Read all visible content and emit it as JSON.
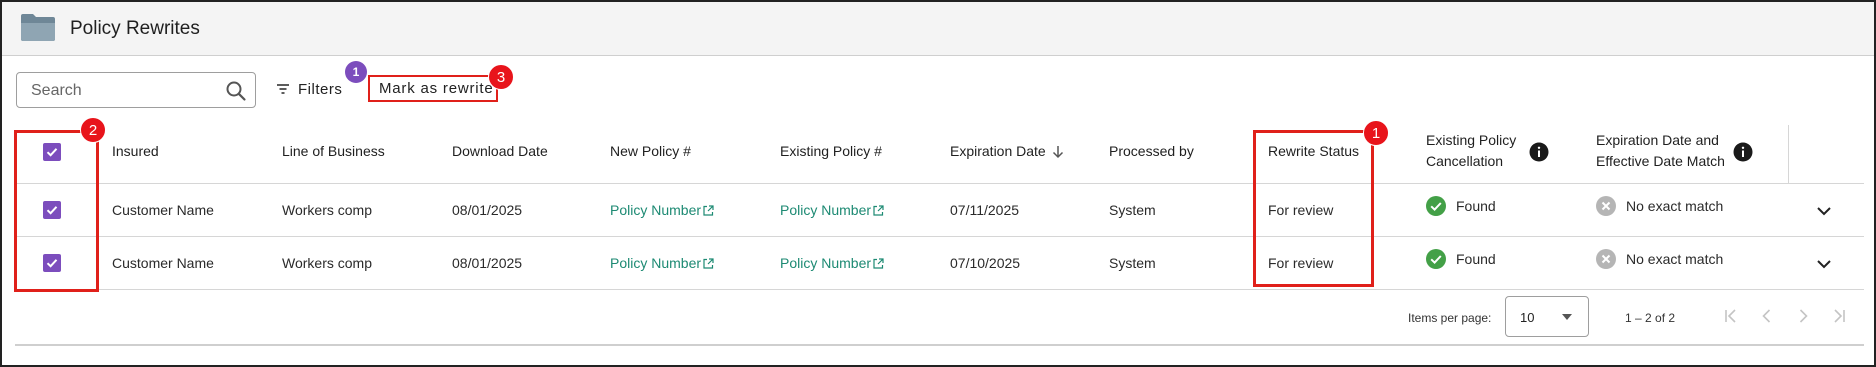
{
  "header": {
    "title": "Policy Rewrites",
    "icon": "folder-icon"
  },
  "toolbar": {
    "search_placeholder": "Search",
    "filters_label": "Filters",
    "filters_count": "1",
    "mark_rewrite_label": "Mark as rewrite"
  },
  "callouts": {
    "select_column": "2",
    "rewrite_status": "1",
    "mark_button": "3"
  },
  "table": {
    "columns": {
      "insured": "Insured",
      "line_of_business": "Line of Business",
      "download_date": "Download Date",
      "new_policy": "New Policy #",
      "existing_policy": "Existing Policy #",
      "expiration_date": "Expiration Date",
      "processed_by": "Processed by",
      "rewrite_status": "Rewrite Status",
      "existing_policy_cancellation_1": "Existing Policy",
      "existing_policy_cancellation_2": "Cancellation",
      "expiration_effective_match_1": "Expiration Date and",
      "expiration_effective_match_2": "Effective Date Match"
    },
    "rows": [
      {
        "insured": "Customer Name",
        "line_of_business": "Workers comp",
        "download_date": "08/01/2025",
        "new_policy": "Policy Number",
        "existing_policy": "Policy Number",
        "expiration_date": "07/11/2025",
        "processed_by": "System",
        "rewrite_status": "For review",
        "cancellation": "Found",
        "date_match": "No exact match"
      },
      {
        "insured": "Customer Name",
        "line_of_business": "Workers comp",
        "download_date": "08/01/2025",
        "new_policy": "Policy Number",
        "existing_policy": "Policy Number",
        "expiration_date": "07/10/2025",
        "processed_by": "System",
        "rewrite_status": "For review",
        "cancellation": "Found",
        "date_match": "No exact match"
      }
    ]
  },
  "paginator": {
    "items_per_page_label": "Items per page:",
    "items_per_page_value": "10",
    "range_label": "1 – 2 of 2"
  },
  "colors": {
    "accent_purple": "#7c4dbd",
    "link_green": "#1d8a73",
    "status_green": "#43a047",
    "highlight_red": "#e0201a"
  }
}
